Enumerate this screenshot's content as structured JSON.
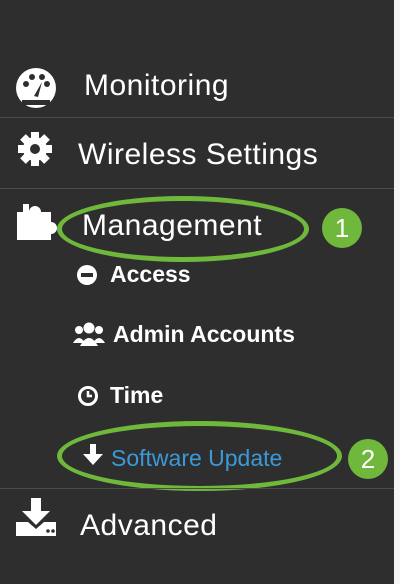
{
  "menu": {
    "monitoring": {
      "label": "Monitoring",
      "icon": "dashboard-icon"
    },
    "wireless": {
      "label": "Wireless Settings",
      "icon": "gear-icon"
    },
    "management": {
      "label": "Management",
      "icon": "puzzle-icon"
    },
    "submenu": [
      {
        "label": "Access",
        "icon": "minus-circle-icon",
        "active": false
      },
      {
        "label": "Admin Accounts",
        "icon": "users-icon",
        "active": false
      },
      {
        "label": "Time",
        "icon": "clock-icon",
        "active": false
      },
      {
        "label": "Software Update",
        "icon": "arrow-down-icon",
        "active": true
      }
    ],
    "advanced": {
      "label": "Advanced",
      "icon": "download-tray-icon"
    }
  },
  "callouts": [
    "1",
    "2"
  ],
  "colors": {
    "background": "#2e2e2e",
    "active_text": "#3a9ad9",
    "callout": "#6fb83c"
  }
}
